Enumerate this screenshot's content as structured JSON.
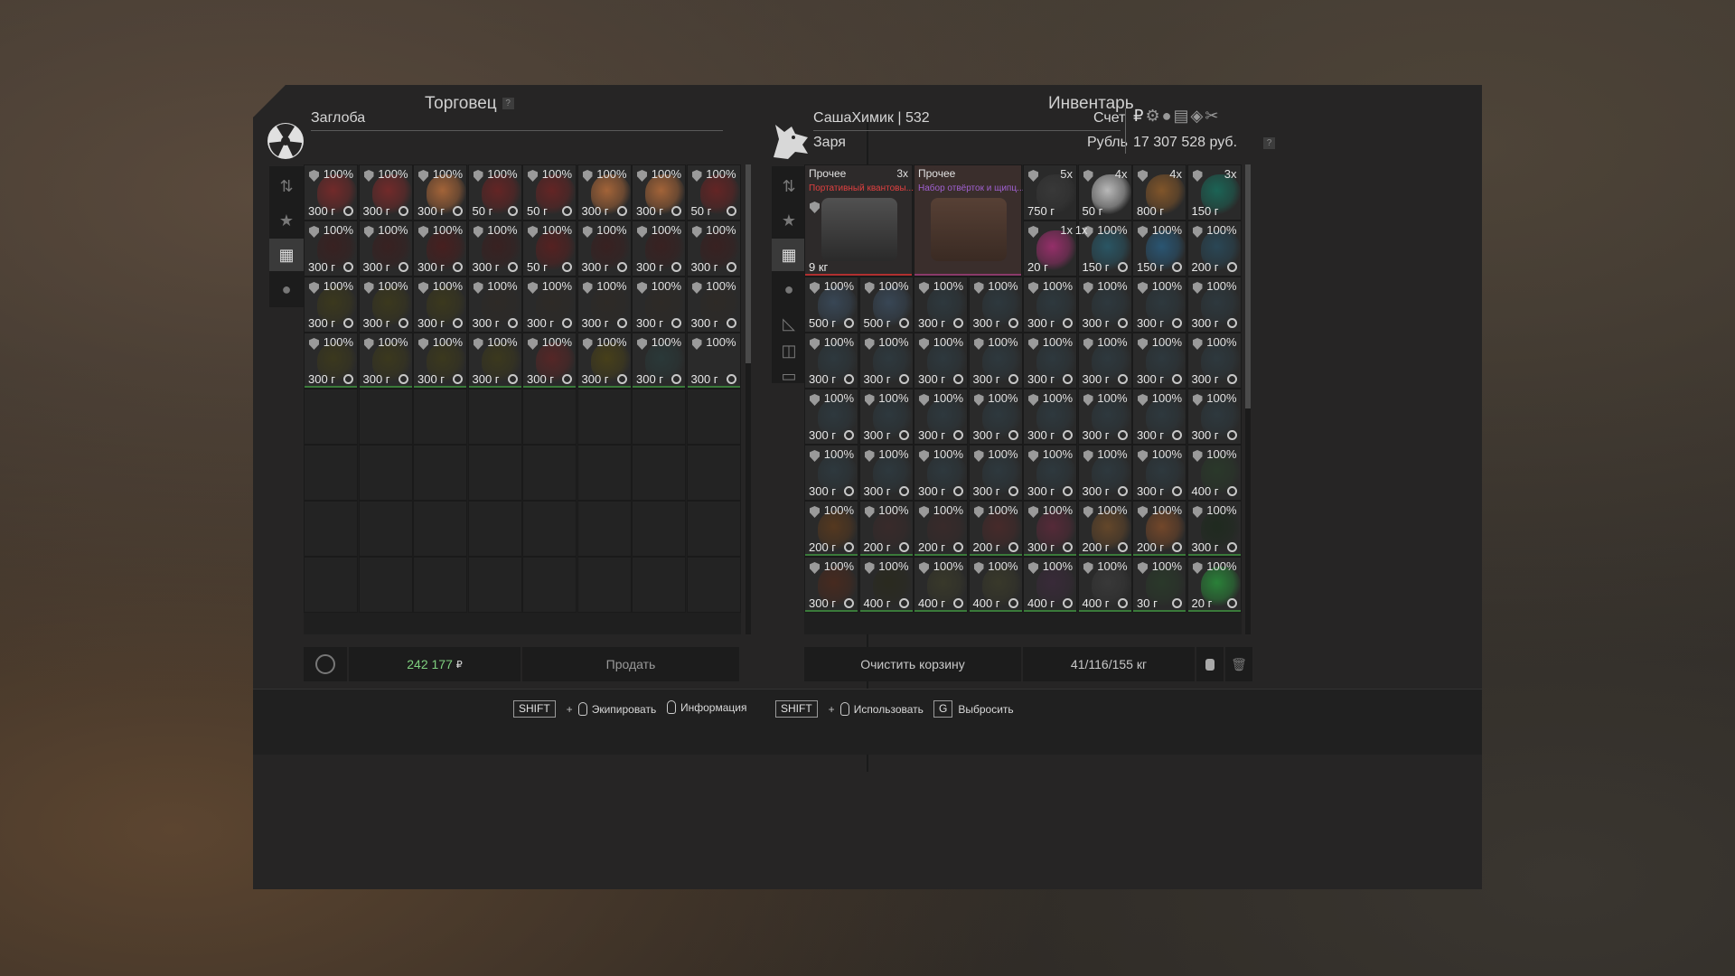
{
  "trader": {
    "title": "Торговец",
    "help": "?",
    "name": "Заглоба",
    "balance": "242 177",
    "balance_currency": "₽",
    "sell_label": "Продать",
    "items": [
      {
        "pct": "100%",
        "price": "300 г",
        "art": "#7a2a2a"
      },
      {
        "pct": "100%",
        "price": "300 г",
        "art": "#7a2a2a"
      },
      {
        "pct": "100%",
        "price": "300 г",
        "art": "#b06a3a"
      },
      {
        "pct": "100%",
        "price": "50 г",
        "art": "#6a2424"
      },
      {
        "pct": "100%",
        "price": "50 г",
        "art": "#6a2424"
      },
      {
        "pct": "100%",
        "price": "300 г",
        "art": "#b06a3a"
      },
      {
        "pct": "100%",
        "price": "300 г",
        "art": "#b06a3a"
      },
      {
        "pct": "100%",
        "price": "50 г",
        "art": "#6a2424"
      },
      {
        "pct": "100%",
        "price": "300 г",
        "art": "#3a2020"
      },
      {
        "pct": "100%",
        "price": "300 г",
        "art": "#3a2020"
      },
      {
        "pct": "100%",
        "price": "300 г",
        "art": "#4a1e1e"
      },
      {
        "pct": "100%",
        "price": "300 г",
        "art": "#3a2020"
      },
      {
        "pct": "100%",
        "price": "50 г",
        "art": "#5a2020"
      },
      {
        "pct": "100%",
        "price": "300 г",
        "art": "#3a2020"
      },
      {
        "pct": "100%",
        "price": "300 г",
        "art": "#3a2020"
      },
      {
        "pct": "100%",
        "price": "300 г",
        "art": "#3a2020"
      },
      {
        "pct": "100%",
        "price": "300 г",
        "art": "#3d3a1c"
      },
      {
        "pct": "100%",
        "price": "300 г",
        "art": "#3d3a1c"
      },
      {
        "pct": "100%",
        "price": "300 г",
        "art": "#3d3a1c"
      },
      {
        "pct": "100%",
        "price": "300 г",
        "art": "#2e2a26"
      },
      {
        "pct": "100%",
        "price": "300 г",
        "art": "#2e2a26"
      },
      {
        "pct": "100%",
        "price": "300 г",
        "art": "#2e2a26"
      },
      {
        "pct": "100%",
        "price": "300 г",
        "art": "#2e2a26"
      },
      {
        "pct": "100%",
        "price": "300 г",
        "art": "#2e2a26"
      },
      {
        "pct": "100%",
        "price": "300 г",
        "art": "#3d3a1c"
      },
      {
        "pct": "100%",
        "price": "300 г",
        "art": "#3d3a1c"
      },
      {
        "pct": "100%",
        "price": "300 г",
        "art": "#3d3a1c"
      },
      {
        "pct": "100%",
        "price": "300 г",
        "art": "#3d3a1c"
      },
      {
        "pct": "100%",
        "price": "300 г",
        "art": "#5a2626"
      },
      {
        "pct": "100%",
        "price": "300 г",
        "art": "#4a4218"
      },
      {
        "pct": "100%",
        "price": "300 г",
        "art": "#2a3a3a"
      },
      {
        "pct": "100%",
        "price": "300 г",
        "art": "#2a2a2a"
      }
    ]
  },
  "inventory": {
    "title": "Инвентарь",
    "player": "СашаХимик | 532",
    "faction": "Заря",
    "account_label": "Счет",
    "currency_label": "Рубль",
    "money": "17 307 528 руб.",
    "help": "?",
    "clear_label": "Очистить корзину",
    "weight": "41/116/155 кг",
    "big_items": [
      {
        "category": "Прочее",
        "count": "3x",
        "name": "Портативный квантовы...",
        "price": "9 кг",
        "name_color": "#e04040"
      },
      {
        "category": "Прочее",
        "count": "",
        "name": "Набор отвёрток и щипц...",
        "price": "",
        "name_color": "#a060d0"
      }
    ],
    "top_items": [
      {
        "count": "5x",
        "price": "750 г",
        "art": "#3a3a3a"
      },
      {
        "count": "4x",
        "price": "50 г",
        "art": "#c8c8c8"
      },
      {
        "count": "4x",
        "price": "800 г",
        "art": "#8a5a2a"
      },
      {
        "count": "3x",
        "price": "150 г",
        "art": "#1a6a5a"
      }
    ],
    "row2_items": [
      {
        "count": "1x",
        "pct": "",
        "price": "20 г",
        "art": "#a03070"
      },
      {
        "count": "1x",
        "pct": "100%",
        "price": "150 г",
        "art": "#2a5a6a"
      },
      {
        "count": "",
        "pct": "100%",
        "price": "150 г",
        "art": "#2a5a7a"
      },
      {
        "count": "",
        "pct": "100%",
        "price": "200 г",
        "art": "#2a4a5a"
      }
    ],
    "items": [
      {
        "pct": "100%",
        "price": "500 г",
        "art": "#3a4a5a"
      },
      {
        "pct": "100%",
        "price": "500 г",
        "art": "#3a4a5a"
      },
      {
        "pct": "100%",
        "price": "300 г",
        "art": "#2e3a40"
      },
      {
        "pct": "100%",
        "price": "300 г",
        "art": "#2e3a40"
      },
      {
        "pct": "100%",
        "price": "300 г",
        "art": "#2e3a40"
      },
      {
        "pct": "100%",
        "price": "300 г",
        "art": "#2e3a40"
      },
      {
        "pct": "100%",
        "price": "300 г",
        "art": "#2e3a40"
      },
      {
        "pct": "100%",
        "price": "300 г",
        "art": "#2e3a40"
      },
      {
        "pct": "100%",
        "price": "300 г",
        "art": "#2e3a40"
      },
      {
        "pct": "100%",
        "price": "300 г",
        "art": "#2e3a40"
      },
      {
        "pct": "100%",
        "price": "300 г",
        "art": "#2e3a40"
      },
      {
        "pct": "100%",
        "price": "300 г",
        "art": "#2e3a40"
      },
      {
        "pct": "100%",
        "price": "300 г",
        "art": "#2e3a40"
      },
      {
        "pct": "100%",
        "price": "300 г",
        "art": "#2e3a40"
      },
      {
        "pct": "100%",
        "price": "300 г",
        "art": "#2e3a40"
      },
      {
        "pct": "100%",
        "price": "300 г",
        "art": "#2e3a40"
      },
      {
        "pct": "100%",
        "price": "300 г",
        "art": "#2e3a40"
      },
      {
        "pct": "100%",
        "price": "300 г",
        "art": "#2e3a40"
      },
      {
        "pct": "100%",
        "price": "300 г",
        "art": "#2e3a40"
      },
      {
        "pct": "100%",
        "price": "300 г",
        "art": "#2e3a40"
      },
      {
        "pct": "100%",
        "price": "300 г",
        "art": "#2e3a40"
      },
      {
        "pct": "100%",
        "price": "300 г",
        "art": "#2e3a40"
      },
      {
        "pct": "100%",
        "price": "300 г",
        "art": "#2e3a40"
      },
      {
        "pct": "100%",
        "price": "300 г",
        "art": "#2e3a40"
      },
      {
        "pct": "100%",
        "price": "300 г",
        "art": "#2e3a40"
      },
      {
        "pct": "100%",
        "price": "300 г",
        "art": "#2e3a40"
      },
      {
        "pct": "100%",
        "price": "300 г",
        "art": "#2e3a40"
      },
      {
        "pct": "100%",
        "price": "300 г",
        "art": "#2e3a40"
      },
      {
        "pct": "100%",
        "price": "300 г",
        "art": "#2e3a40"
      },
      {
        "pct": "100%",
        "price": "300 г",
        "art": "#2e3a40"
      },
      {
        "pct": "100%",
        "price": "300 г",
        "art": "#2e3a40"
      },
      {
        "pct": "100%",
        "price": "400 г",
        "art": "#2a3a2a"
      },
      {
        "pct": "100%",
        "price": "200 г",
        "art": "#5a3a1e"
      },
      {
        "pct": "100%",
        "price": "200 г",
        "art": "#3a2a2a"
      },
      {
        "pct": "100%",
        "price": "200 г",
        "art": "#3a2a2a"
      },
      {
        "pct": "100%",
        "price": "200 г",
        "art": "#4a2a2a"
      },
      {
        "pct": "100%",
        "price": "300 г",
        "art": "#5a2a3a"
      },
      {
        "pct": "100%",
        "price": "200 г",
        "art": "#6a4a2a"
      },
      {
        "pct": "100%",
        "price": "200 г",
        "art": "#7a4a2a"
      },
      {
        "pct": "100%",
        "price": "300 г",
        "art": "#1e2a1e"
      },
      {
        "pct": "100%",
        "price": "300 г",
        "art": "#4a2a1e"
      },
      {
        "pct": "100%",
        "price": "400 г",
        "art": "#2a2a1e"
      },
      {
        "pct": "100%",
        "price": "400 г",
        "art": "#3a3a2a"
      },
      {
        "pct": "100%",
        "price": "400 г",
        "art": "#3a3a2a"
      },
      {
        "pct": "100%",
        "price": "400 г",
        "art": "#3a2a3a"
      },
      {
        "pct": "100%",
        "price": "400 г",
        "art": "#3a3a3a"
      },
      {
        "pct": "100%",
        "price": "30 г",
        "art": "#2a3a2a"
      },
      {
        "pct": "100%",
        "price": "20 г",
        "art": "#2a8a3a"
      }
    ]
  },
  "hints": [
    {
      "key": "SHIFT",
      "mouse": true,
      "label": "Экипировать"
    },
    {
      "key": "",
      "mouse": true,
      "label": "Информация"
    },
    {
      "key": "SHIFT",
      "mouse": true,
      "label": "Использовать"
    },
    {
      "key": "G",
      "mouse": false,
      "label": "Выбросить"
    }
  ],
  "colors": {
    "money_green": "#7fd07f",
    "accent": "#cfcfcf"
  }
}
